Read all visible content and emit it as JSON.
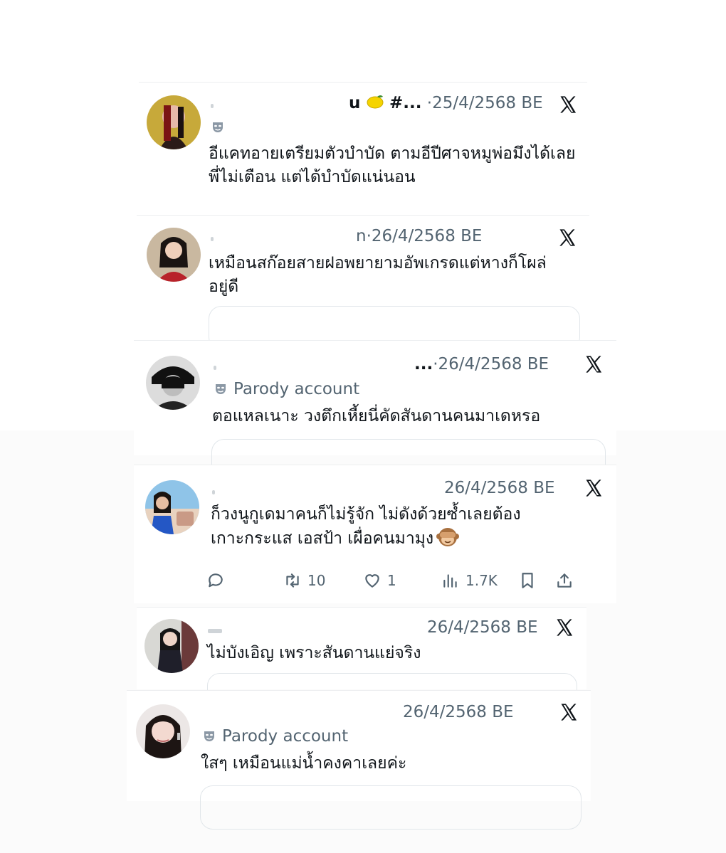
{
  "tweets": [
    {
      "name": "u",
      "handle": "#...",
      "sep": "·",
      "date": "25/4/2568 BE",
      "badge": "",
      "text": "อีแคทอายเตรียมตัวบำบัด ตามอีปีศาจหมูพ่อมึงได้เลย พี่ไม่เตือน แต่ได้บำบัดแน่นอน"
    },
    {
      "name": "",
      "handle": "n",
      "sep": "·",
      "date": "26/4/2568 BE",
      "badge": "",
      "text": "เหมือนสก๊อยสายฝอพยายามอัพเกรดแต่หางก็โผล่อยู่ดี"
    },
    {
      "name": "",
      "handle": "...",
      "sep": "·",
      "date": "26/4/2568 BE",
      "badge": "Parody account",
      "text": "ตอแหลเนาะ วงตึกเหี้ยนี่คัดสันดานคนมาเดหรอ"
    },
    {
      "name": "",
      "handle": "",
      "sep": "",
      "date": "26/4/2568 BE",
      "badge": "",
      "text": "ก็วงนูกูเดมาคนก็ไม่รู้จัก ไม่ดังด้วยซ้ำเลยต้องเกาะกระแส เอสป้า เผื่อคนมามุง",
      "actions": {
        "retweets": "10",
        "likes": "1",
        "views": "1.7K"
      }
    },
    {
      "name": "",
      "handle": "",
      "sep": "",
      "date": "26/4/2568 BE",
      "badge": "",
      "text": "ไม่บังเอิญ เพราะสันดานแย่จริง"
    },
    {
      "name": "",
      "handle": "",
      "sep": "",
      "date": "26/4/2568 BE",
      "badge": "Parody account",
      "text": "ใสๆ เหมือนแม่น้ำคงคาเลยค่ะ"
    }
  ],
  "icons": {
    "platform": "x-logo-icon",
    "parody": "parody-mask-icon",
    "reply": "reply-icon",
    "retweet": "retweet-icon",
    "like": "heart-icon",
    "views": "views-icon",
    "bookmark": "bookmark-icon",
    "share": "share-icon"
  },
  "colors": {
    "text": "#0f1419",
    "secondary": "#536471",
    "border": "#e1e6ea"
  }
}
